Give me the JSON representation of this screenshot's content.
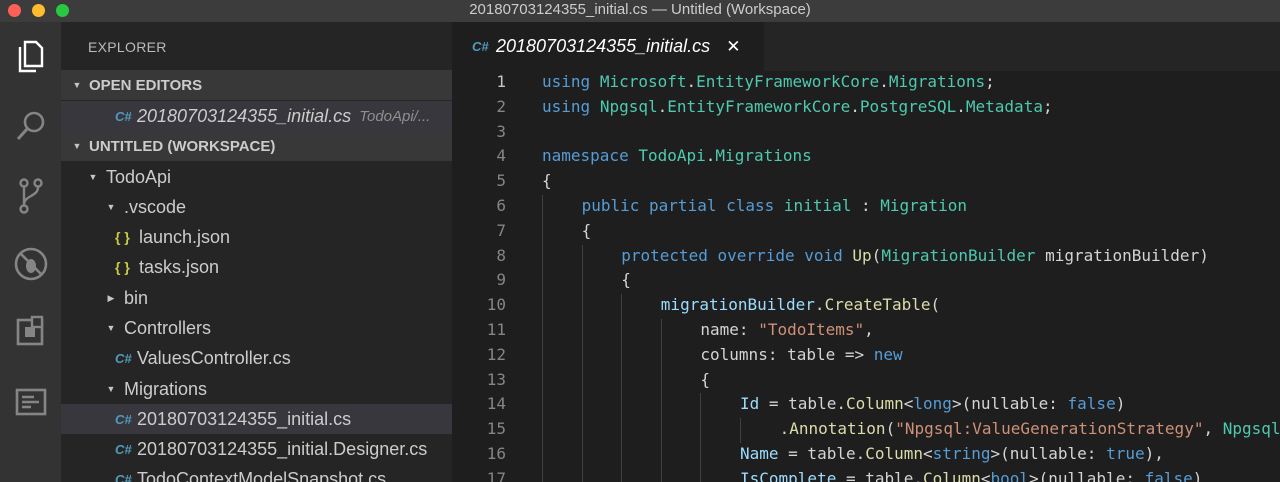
{
  "window": {
    "title": "20180703124355_initial.cs — Untitled (Workspace)"
  },
  "activity_bar": [
    {
      "name": "explorer-icon"
    },
    {
      "name": "search-icon"
    },
    {
      "name": "source-control-icon"
    },
    {
      "name": "debug-icon"
    },
    {
      "name": "extensions-icon"
    },
    {
      "name": "outline-icon"
    }
  ],
  "sidebar": {
    "title": "EXPLORER",
    "open_editors": {
      "label": "OPEN EDITORS",
      "items": [
        {
          "icon": "C#",
          "name": "20180703124355_initial.cs",
          "hint": "TodoApi/..."
        }
      ]
    },
    "workspace": {
      "label": "UNTITLED (WORKSPACE)",
      "tree": [
        {
          "label": "TodoApi",
          "kind": "folder-open",
          "depth": 0
        },
        {
          "label": ".vscode",
          "kind": "folder-open",
          "depth": 1
        },
        {
          "label": "launch.json",
          "kind": "json",
          "icon": "{ }",
          "depth": 2
        },
        {
          "label": "tasks.json",
          "kind": "json",
          "icon": "{ }",
          "depth": 2
        },
        {
          "label": "bin",
          "kind": "folder-closed",
          "depth": 1
        },
        {
          "label": "Controllers",
          "kind": "folder-open",
          "depth": 1
        },
        {
          "label": "ValuesController.cs",
          "kind": "cs",
          "icon": "C#",
          "depth": 2
        },
        {
          "label": "Migrations",
          "kind": "folder-open",
          "depth": 1
        },
        {
          "label": "20180703124355_initial.cs",
          "kind": "cs",
          "icon": "C#",
          "depth": 2,
          "selected": true
        },
        {
          "label": "20180703124355_initial.Designer.cs",
          "kind": "cs",
          "icon": "C#",
          "depth": 2
        },
        {
          "label": "TodoContextModelSnapshot.cs",
          "kind": "cs",
          "icon": "C#",
          "depth": 2
        }
      ]
    }
  },
  "editor": {
    "tab": {
      "icon": "C#",
      "label": "20180703124355_initial.cs",
      "close": "✕"
    },
    "lines": [
      {
        "n": "1",
        "indent": 0,
        "tokens": [
          [
            "kw",
            "using"
          ],
          [
            "pl",
            " "
          ],
          [
            "ty",
            "Microsoft"
          ],
          [
            "pl",
            "."
          ],
          [
            "ty",
            "EntityFrameworkCore"
          ],
          [
            "pl",
            "."
          ],
          [
            "ty",
            "Migrations"
          ],
          [
            "pl",
            ";"
          ]
        ]
      },
      {
        "n": "2",
        "indent": 0,
        "tokens": [
          [
            "kw",
            "using"
          ],
          [
            "pl",
            " "
          ],
          [
            "ty",
            "Npgsql"
          ],
          [
            "pl",
            "."
          ],
          [
            "ty",
            "EntityFrameworkCore"
          ],
          [
            "pl",
            "."
          ],
          [
            "ty",
            "PostgreSQL"
          ],
          [
            "pl",
            "."
          ],
          [
            "ty",
            "Metadata"
          ],
          [
            "pl",
            ";"
          ]
        ]
      },
      {
        "n": "3",
        "indent": 0,
        "tokens": []
      },
      {
        "n": "4",
        "indent": 0,
        "tokens": [
          [
            "kw",
            "namespace"
          ],
          [
            "pl",
            " "
          ],
          [
            "ty",
            "TodoApi"
          ],
          [
            "pl",
            "."
          ],
          [
            "ty",
            "Migrations"
          ]
        ]
      },
      {
        "n": "5",
        "indent": 0,
        "tokens": [
          [
            "pl",
            "{"
          ]
        ]
      },
      {
        "n": "6",
        "indent": 1,
        "tokens": [
          [
            "kw",
            "public"
          ],
          [
            "pl",
            " "
          ],
          [
            "kw",
            "partial"
          ],
          [
            "pl",
            " "
          ],
          [
            "kw",
            "class"
          ],
          [
            "pl",
            " "
          ],
          [
            "ty",
            "initial"
          ],
          [
            "pl",
            " : "
          ],
          [
            "ty",
            "Migration"
          ]
        ]
      },
      {
        "n": "7",
        "indent": 1,
        "tokens": [
          [
            "pl",
            "{"
          ]
        ]
      },
      {
        "n": "8",
        "indent": 2,
        "tokens": [
          [
            "kw",
            "protected"
          ],
          [
            "pl",
            " "
          ],
          [
            "kw",
            "override"
          ],
          [
            "pl",
            " "
          ],
          [
            "kw",
            "void"
          ],
          [
            "pl",
            " "
          ],
          [
            "fn",
            "Up"
          ],
          [
            "pl",
            "("
          ],
          [
            "ty",
            "MigrationBuilder"
          ],
          [
            "pl",
            " migrationBuilder)"
          ]
        ]
      },
      {
        "n": "9",
        "indent": 2,
        "tokens": [
          [
            "pl",
            "{"
          ]
        ]
      },
      {
        "n": "10",
        "indent": 3,
        "tokens": [
          [
            "id",
            "migrationBuilder"
          ],
          [
            "pl",
            "."
          ],
          [
            "fn",
            "CreateTable"
          ],
          [
            "pl",
            "("
          ]
        ]
      },
      {
        "n": "11",
        "indent": 4,
        "tokens": [
          [
            "pl",
            "name: "
          ],
          [
            "str",
            "\"TodoItems\""
          ],
          [
            "pl",
            ","
          ]
        ]
      },
      {
        "n": "12",
        "indent": 4,
        "tokens": [
          [
            "pl",
            "columns: table => "
          ],
          [
            "kw",
            "new"
          ]
        ]
      },
      {
        "n": "13",
        "indent": 4,
        "tokens": [
          [
            "pl",
            "{"
          ]
        ]
      },
      {
        "n": "14",
        "indent": 5,
        "tokens": [
          [
            "id",
            "Id"
          ],
          [
            "pl",
            " = table."
          ],
          [
            "fn",
            "Column"
          ],
          [
            "pl",
            "<"
          ],
          [
            "kw",
            "long"
          ],
          [
            "pl",
            ">(nullable: "
          ],
          [
            "kw",
            "false"
          ],
          [
            "pl",
            ")"
          ]
        ]
      },
      {
        "n": "15",
        "indent": 6,
        "tokens": [
          [
            "pl",
            "."
          ],
          [
            "fn",
            "Annotation"
          ],
          [
            "pl",
            "("
          ],
          [
            "str",
            "\"Npgsql:ValueGenerationStrategy\""
          ],
          [
            "pl",
            ", "
          ],
          [
            "ty",
            "Npgsql"
          ]
        ]
      },
      {
        "n": "16",
        "indent": 5,
        "tokens": [
          [
            "id",
            "Name"
          ],
          [
            "pl",
            " = table."
          ],
          [
            "fn",
            "Column"
          ],
          [
            "pl",
            "<"
          ],
          [
            "kw",
            "string"
          ],
          [
            "pl",
            ">(nullable: "
          ],
          [
            "kw",
            "true"
          ],
          [
            "pl",
            "),"
          ]
        ]
      },
      {
        "n": "17",
        "indent": 5,
        "tokens": [
          [
            "id",
            "IsComplete"
          ],
          [
            "pl",
            " = table."
          ],
          [
            "fn",
            "Column"
          ],
          [
            "pl",
            "<"
          ],
          [
            "kw",
            "bool"
          ],
          [
            "pl",
            ">(nullable: "
          ],
          [
            "kw",
            "false"
          ],
          [
            "pl",
            ")"
          ]
        ]
      }
    ]
  }
}
